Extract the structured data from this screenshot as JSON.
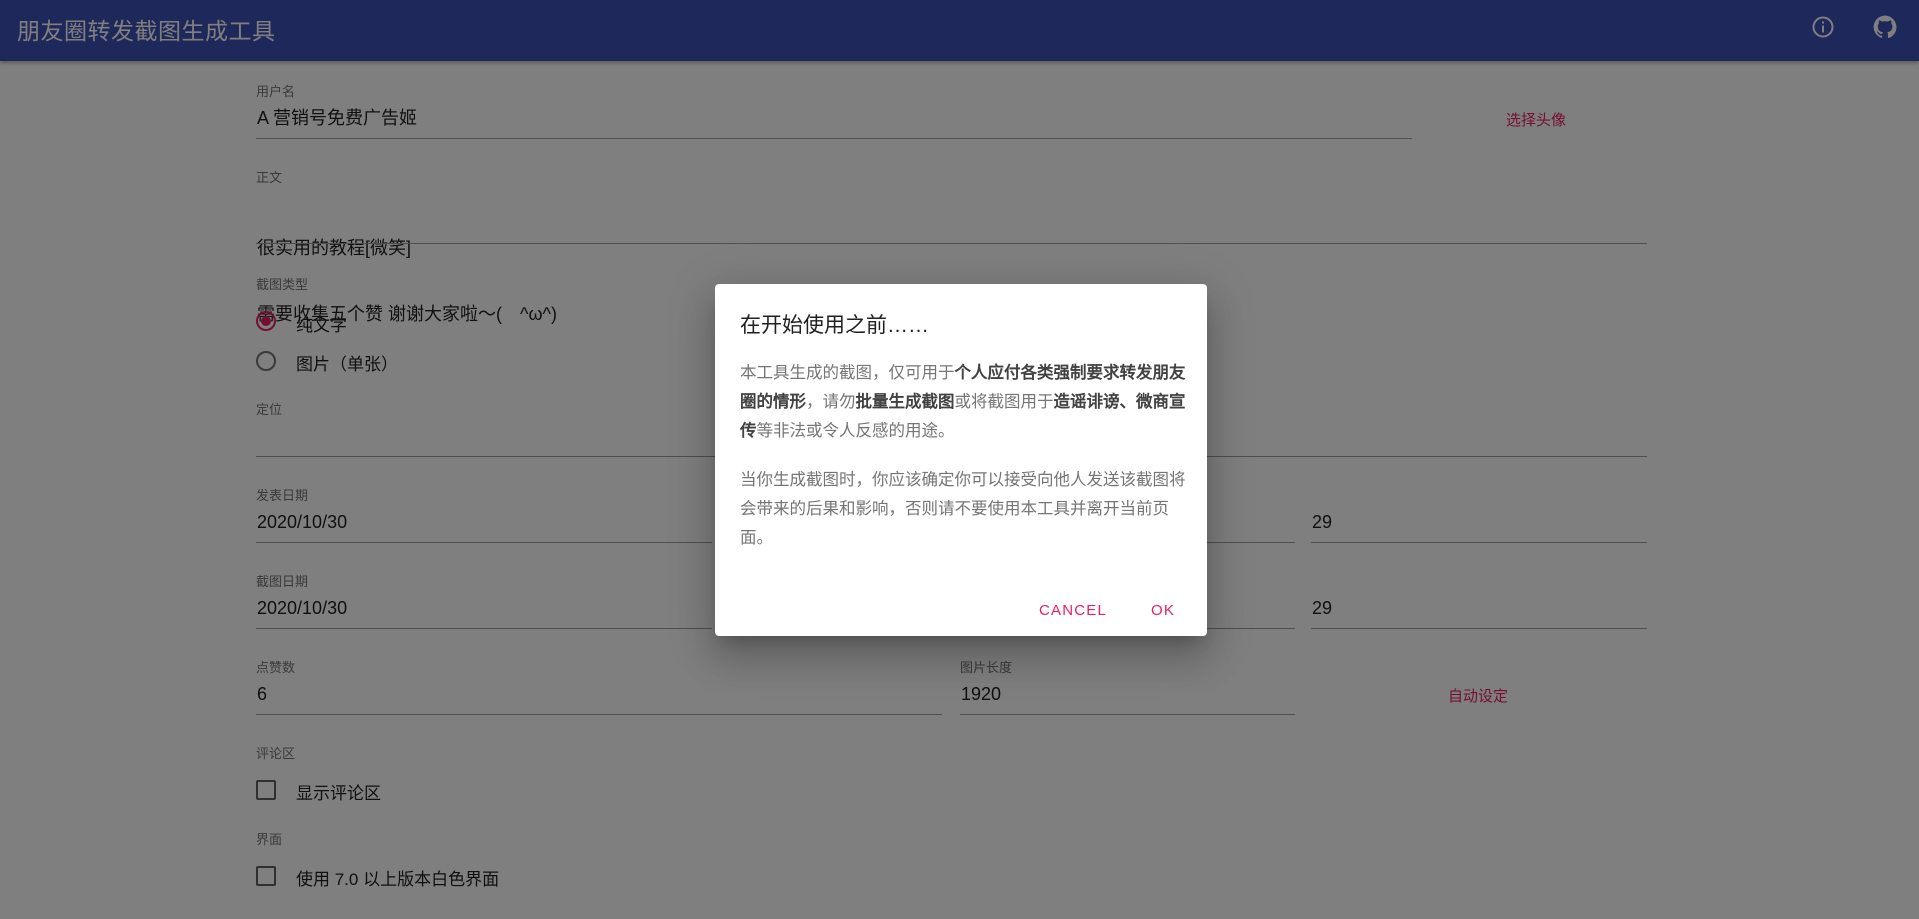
{
  "app": {
    "title": "朋友圈转发截图生成工具",
    "bar_color": "#3f51b5",
    "accent_color": "#e91e63",
    "icons": [
      "info-icon",
      "github-icon"
    ]
  },
  "form": {
    "username": {
      "label": "用户名",
      "value": "A 营销号免费广告姬"
    },
    "choose_avatar": "选择头像",
    "content": {
      "label": "正文",
      "line1": "很实用的教程[微笑]",
      "line2": "需要收集五个赞 谢谢大家啦～(　^ω^)"
    },
    "shot_type": {
      "label": "截图类型",
      "options": [
        {
          "label": "纯文字",
          "checked": true
        },
        {
          "label": "图片（单张）",
          "checked": false
        }
      ]
    },
    "location": {
      "label": "定位",
      "value": ""
    },
    "post_date": {
      "label": "发表日期",
      "value": "2020/10/30",
      "time_value": "29"
    },
    "shot_date": {
      "label": "截图日期",
      "value": "2020/10/30",
      "time_value": "29"
    },
    "likes": {
      "label": "点赞数",
      "value": "6"
    },
    "image_length": {
      "label": "图片长度",
      "value": "1920"
    },
    "auto_set": "自动设定",
    "comments": {
      "label": "评论区",
      "checkbox_label": "显示评论区",
      "checked": false
    },
    "ui": {
      "label": "界面",
      "checkbox_label": "使用 7.0 以上版本白色界面",
      "checked": false
    }
  },
  "dialog": {
    "title": "在开始使用之前……",
    "p1_a": "本工具生成的截图，仅可用于",
    "p1_b": "个人应付各类强制要求转发朋友圈的情形",
    "p1_c": "，请勿",
    "p1_d": "批量生成截图",
    "p1_e": "或将截图用于",
    "p1_f": "造谣诽谤、微商宣传",
    "p1_g": "等非法或令人反感的用途。",
    "p2": "当你生成截图时，你应该确定你可以接受向他人发送该截图将会带来的后果和影响，否则请不要使用本工具并离开当前页面。",
    "cancel": "CANCEL",
    "ok": "OK"
  }
}
